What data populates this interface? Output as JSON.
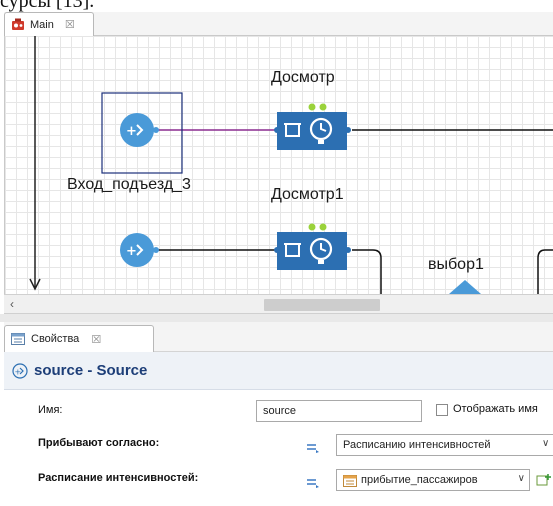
{
  "caption": {
    "text": "сурсы [13]."
  },
  "editor": {
    "tab_label": "Main",
    "tab_close": "☒"
  },
  "canvas": {
    "blocks": [
      {
        "label": "Досмотр"
      },
      {
        "label": "Досмотр1"
      },
      {
        "label": "Вход_подъезд_3"
      },
      {
        "label": "выбор1"
      }
    ],
    "colors": {
      "source": "#4a9ad8",
      "delay": "#2c6fb2",
      "selection": "#1b2f7a",
      "link": "#8a2b8f"
    }
  },
  "scrollbar": {
    "left_arrow": "‹"
  },
  "properties": {
    "tab_label": "Свойства",
    "tab_close": "☒",
    "title": "source - Source",
    "fields": {
      "name_label": "Имя:",
      "name_value": "source",
      "show_name_label": "Отображать имя",
      "arrive_label": "Прибывают согласно:",
      "arrive_value": "Расписанию интенсивностей",
      "schedule_label": "Расписание интенсивностей:",
      "schedule_value": "прибытие_пассажиров"
    }
  }
}
